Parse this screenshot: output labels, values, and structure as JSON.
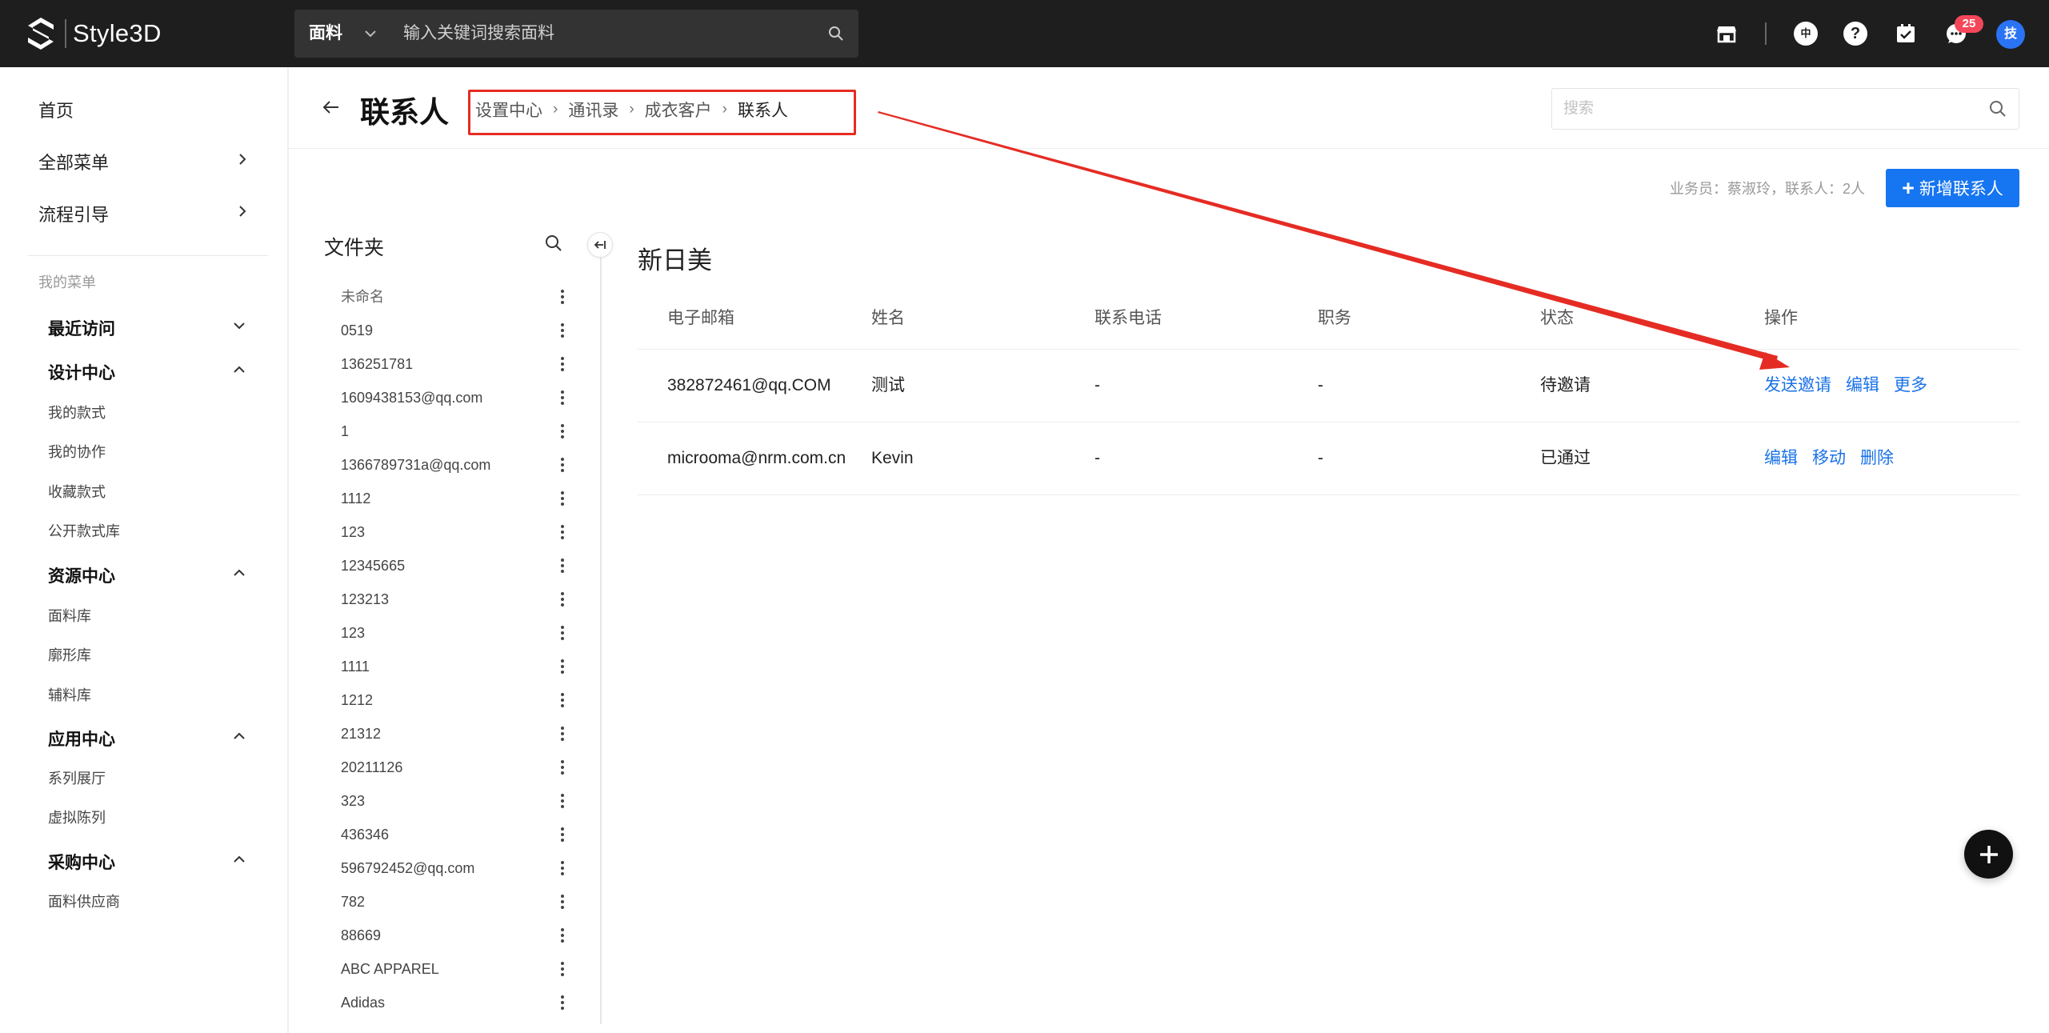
{
  "app": {
    "name": "Style3D"
  },
  "topbar": {
    "search_category": "面料",
    "search_placeholder": "输入关键词搜索面料",
    "notification_count": "25",
    "language_label": "中",
    "user_initial": "技"
  },
  "sidebar": {
    "home": "首页",
    "all_menu": "全部菜单",
    "process_guide": "流程引导",
    "my_menu_label": "我的菜单",
    "sections": [
      {
        "title": "最近访问",
        "expanded": false,
        "items": []
      },
      {
        "title": "设计中心",
        "expanded": true,
        "items": [
          "我的款式",
          "我的协作",
          "收藏款式",
          "公开款式库"
        ]
      },
      {
        "title": "资源中心",
        "expanded": true,
        "items": [
          "面料库",
          "廓形库",
          "辅料库"
        ]
      },
      {
        "title": "应用中心",
        "expanded": true,
        "items": [
          "系列展厅",
          "虚拟陈列"
        ]
      },
      {
        "title": "采购中心",
        "expanded": true,
        "items": [
          "面料供应商"
        ]
      }
    ]
  },
  "page": {
    "title": "联系人",
    "breadcrumb": [
      "设置中心",
      "通讯录",
      "成衣客户",
      "联系人"
    ],
    "search_placeholder": "搜索",
    "summary": "业务员：蔡淑玲，联系人：2人",
    "add_button": "新增联系人"
  },
  "folders": {
    "title": "文件夹",
    "items": [
      "未命名",
      "0519",
      "136251781",
      "1609438153@qq.com",
      "1",
      "1366789731a@qq.com",
      "1112",
      "123",
      "12345665",
      "123213",
      "123",
      "1111",
      "1212",
      "21312",
      "20211126",
      "323",
      "436346",
      "596792452@qq.com",
      "782",
      "88669",
      "ABC APPAREL",
      "Adidas"
    ]
  },
  "contacts": {
    "customer_name": "新日美",
    "columns": [
      "电子邮箱",
      "姓名",
      "联系电话",
      "职务",
      "状态",
      "操作"
    ],
    "rows": [
      {
        "email": "382872461@qq.COM",
        "name": "测试",
        "phone": "-",
        "position": "-",
        "status": "待邀请",
        "actions": [
          "发送邀请",
          "编辑",
          "更多"
        ]
      },
      {
        "email": "microoma@nrm.com.cn",
        "name": "Kevin",
        "phone": "-",
        "position": "-",
        "status": "已通过",
        "actions": [
          "编辑",
          "移动",
          "删除"
        ]
      }
    ]
  },
  "colors": {
    "topbar_bg": "#1e1e1e",
    "primary": "#1675f0",
    "link": "#1a72e8",
    "annotation": "#e52c24",
    "badge": "#f5475a"
  }
}
